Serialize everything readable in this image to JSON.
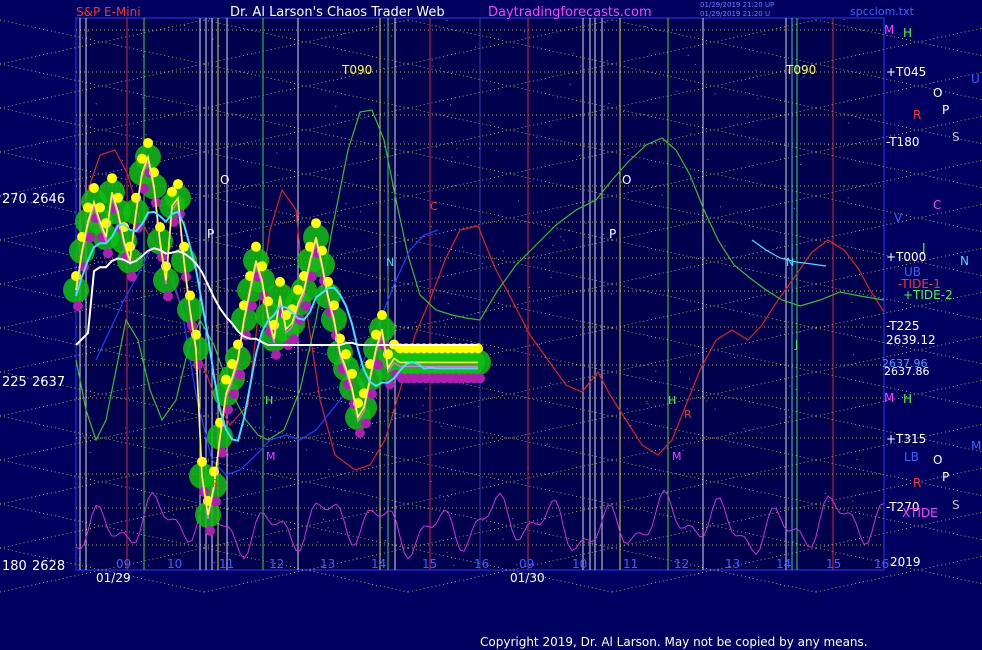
{
  "header": {
    "symbol": "S&P E-Mini",
    "title": "Dr. Al Larson's Chaos Trader Web",
    "site": "Daytradingforecasts.com",
    "stamp1": "01/29/2019 21:20 UP",
    "stamp2": "01/29/2019 21:20 U",
    "file": "spcclom.txt"
  },
  "footer": {
    "copyright": "Copyright 2019, Dr. Al Larson. May not be copied by any means."
  },
  "colors": {
    "background": "#000060",
    "plot_bg": "#000050",
    "grid_yellow": "#e0e060",
    "price_line": "#ffff40",
    "cyan": "#40e0ff",
    "white": "#ffffff",
    "green": "#30c030",
    "blob_green": "#10c010",
    "magenta": "#d030d0",
    "red": "#e02020",
    "blue": "#2040ff"
  },
  "chart_data": {
    "type": "line",
    "title": "S&P E-Mini",
    "y_axis": {
      "ticks": [
        {
          "angle": "270",
          "price": "2646"
        },
        {
          "angle": "225",
          "price": "2637"
        },
        {
          "angle": "180",
          "price": "2628"
        }
      ],
      "ylim": [
        2628,
        2650
      ]
    },
    "x_axis": {
      "hour_labels": [
        "09",
        "10",
        "11",
        "12",
        "13",
        "14",
        "15",
        "16",
        "09",
        "10",
        "11",
        "12",
        "13",
        "14",
        "15",
        "16"
      ],
      "date_labels": [
        "01/29",
        "01/30"
      ]
    },
    "right_labels": [
      {
        "text": "M",
        "color": "#ff40ff"
      },
      {
        "text": "H",
        "color": "#40ff40"
      },
      {
        "text": "+T045",
        "color": "#ffffff"
      },
      {
        "text": "O",
        "color": "#ffffff"
      },
      {
        "text": "U",
        "color": "#4060ff"
      },
      {
        "text": "R",
        "color": "#ff3030"
      },
      {
        "text": "P",
        "color": "#ffffff"
      },
      {
        "text": "S",
        "color": "#c0c0c0"
      },
      {
        "text": "-T180",
        "color": "#ffffff"
      },
      {
        "text": "C",
        "color": "#ff40ff"
      },
      {
        "text": "V",
        "color": "#4060ff"
      },
      {
        "text": "J",
        "color": "#40ff40"
      },
      {
        "text": "+T000",
        "color": "#ffffff"
      },
      {
        "text": "N",
        "color": "#40e0ff"
      },
      {
        "text": "UB",
        "color": "#4060ff"
      },
      {
        "text": "-TIDE-1",
        "color": "#ff3030"
      },
      {
        "text": "+TIDE-2",
        "color": "#40ff40"
      },
      {
        "text": "-T225",
        "color": "#ffffff"
      },
      {
        "text": "2639.12",
        "color": "#ffffff"
      },
      {
        "text": "2637.96",
        "color": "#40a0ff"
      },
      {
        "text": "2637.86",
        "color": "#ffffff"
      },
      {
        "text": "M",
        "color": "#ff40ff"
      },
      {
        "text": "H",
        "color": "#40ff40"
      },
      {
        "text": "+T315",
        "color": "#ffffff"
      },
      {
        "text": "M",
        "color": "#4060ff"
      },
      {
        "text": "LB",
        "color": "#4060ff"
      },
      {
        "text": "O",
        "color": "#ffffff"
      },
      {
        "text": "P",
        "color": "#ffffff"
      },
      {
        "text": "R",
        "color": "#ff3030"
      },
      {
        "text": "-T270",
        "color": "#ffffff"
      },
      {
        "text": "XTIDE",
        "color": "#ff40ff"
      },
      {
        "text": "S",
        "color": "#c0c0c0"
      },
      {
        "text": "2019",
        "color": "#ffffff"
      }
    ],
    "in_chart_labels": [
      "T090",
      "T090",
      "O",
      "P",
      "O",
      "P",
      "N",
      "H",
      "M",
      "H",
      "M",
      "N",
      "J",
      "R",
      "R",
      "C"
    ],
    "series": [
      {
        "type": "price",
        "x": [
          0,
          3,
          6,
          9,
          12,
          15,
          18,
          21,
          24,
          27,
          30,
          33,
          36,
          39,
          42,
          45,
          48,
          51,
          54,
          57,
          60,
          63,
          66,
          69,
          72,
          75,
          78,
          81,
          84,
          87,
          90,
          93,
          96,
          99,
          102,
          105,
          108,
          111,
          114,
          117,
          120,
          123,
          126,
          129,
          132,
          135,
          138,
          141,
          144,
          147,
          150,
          153,
          156,
          159,
          162,
          165,
          168,
          171,
          174,
          177,
          180,
          183,
          186,
          189,
          192,
          195,
          198,
          201,
          204,
          207,
          210
        ],
        "y": [
          2641.5,
          2643.5,
          2645.0,
          2646.0,
          2645.0,
          2644.2,
          2646.5,
          2645.5,
          2644.0,
          2643.0,
          2645.5,
          2647.5,
          2648.3,
          2646.8,
          2644.0,
          2642.0,
          2645.8,
          2646.2,
          2643.0,
          2640.5,
          2638.5,
          2632.0,
          2630.0,
          2631.5,
          2634.0,
          2636.2,
          2637.0,
          2638.0,
          2640.0,
          2641.5,
          2643.0,
          2642.0,
          2640.2,
          2639.0,
          2641.2,
          2639.5,
          2639.8,
          2640.8,
          2641.5,
          2643.0,
          2644.2,
          2642.8,
          2641.2,
          2640.0,
          2638.3,
          2637.5,
          2636.5,
          2635.0,
          2635.5,
          2637.0,
          2638.5,
          2639.5,
          2637.5,
          2638.0,
          2637.8,
          2637.8,
          2637.8,
          2637.8,
          2637.8,
          2637.8,
          2637.8,
          2637.8,
          2637.8,
          2637.8,
          2637.8,
          2637.8,
          2637.8,
          2637.8,
          2637.8,
          2637.8,
          2637.8
        ]
      }
    ]
  }
}
